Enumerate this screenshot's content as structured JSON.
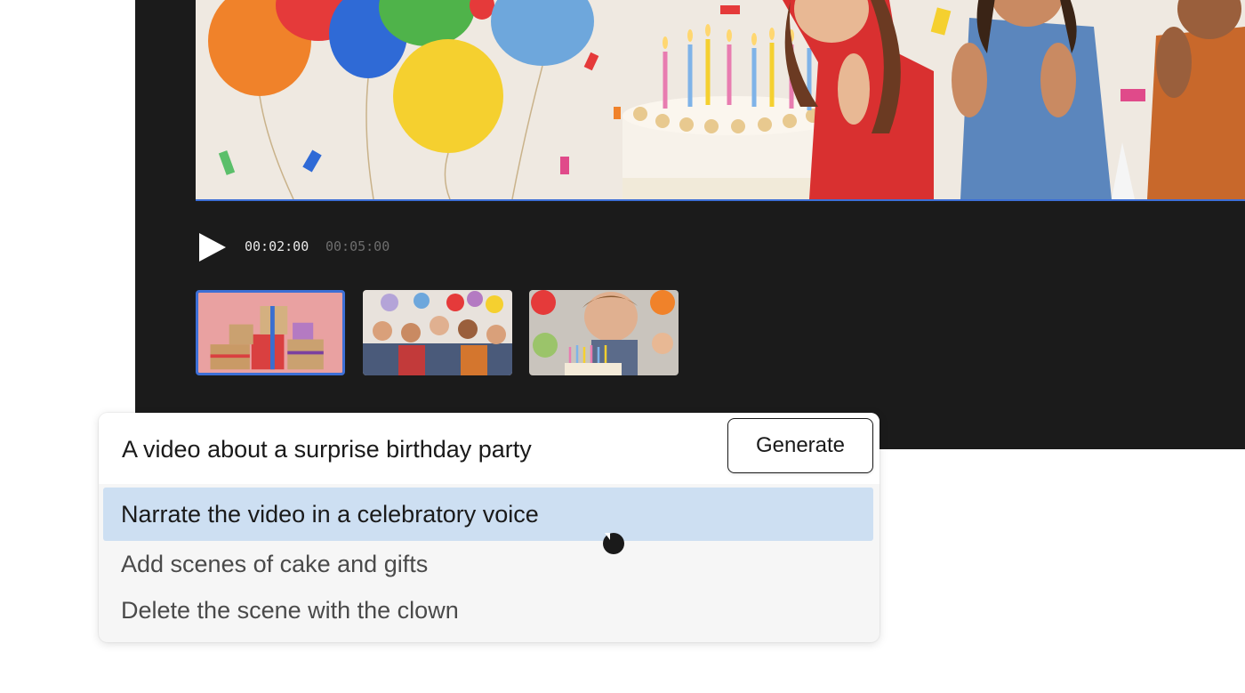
{
  "player": {
    "current_time": "00:02:00",
    "total_time": "00:05:00",
    "selected_clip": 1,
    "clips": [
      "gifts-scene",
      "group-party-scene",
      "cake-blowing-scene"
    ]
  },
  "prompt": {
    "value": "A video about a surprise birthday party",
    "generate_label": "Generate",
    "suggestions": [
      "Narrate the video in a celebratory voice",
      "Add scenes of cake and gifts",
      "Delete the scene with the clown"
    ],
    "active_suggestion": 0
  },
  "colors": {
    "editor_bg": "#1b1b1b",
    "accent": "#3d6fd6",
    "highlight": "#cddff2"
  }
}
